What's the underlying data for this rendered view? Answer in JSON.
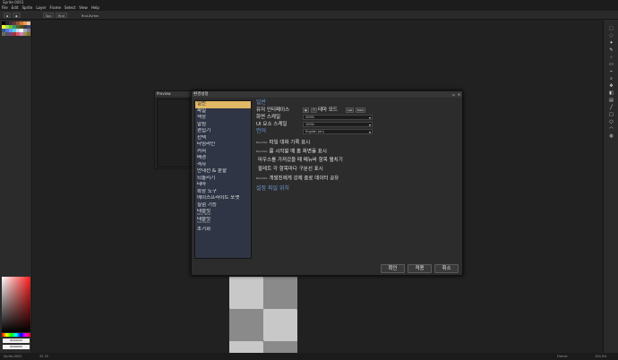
{
  "window": {
    "title": "Sprite-0001"
  },
  "menu": [
    "File",
    "Edit",
    "Sprite",
    "Layer",
    "Frame",
    "Select",
    "View",
    "Help"
  ],
  "toolbar": {
    "btn1": "Spc",
    "btn2": "Rnd",
    "label": "Rnd-Xvrtec"
  },
  "preview": {
    "title": "Preview"
  },
  "dialog": {
    "title": "환경설정",
    "nav": [
      "일반",
      "파일",
      "색상",
      "알림",
      "편집기",
      "선택",
      "타임라인",
      "커서",
      "배경",
      "격자",
      "안내선 & 분할",
      "되돌리기",
      "테마",
      "확장 도구",
      "에이스프라이트 포맷",
      "실험 기능"
    ],
    "nav_group1": {
      "label": "태블릿",
      "sub": "Bitsy, Tablet"
    },
    "nav_group2": {
      "label": "태블릿",
      "sub": "Fast Pointer"
    },
    "nav_reset": "초기화",
    "section_general": "일반",
    "ui_label": "유저 인터페이스",
    "theme_mode": "테마 모드",
    "theme_light": "Lwt",
    "theme_dark": "Dark",
    "screen_scale_label": "화면 스케일",
    "screen_scale_value": "200%",
    "ui_scale_label": "UI 요소 스케일",
    "ui_scale_value": "100%",
    "section_language": "언어",
    "language_value": "English (en)",
    "checks": [
      {
        "tag": "Rendrbx",
        "label": "파일 대화 기록 표시"
      },
      {
        "tag": "Rendrbx",
        "label": "를 시작할 때 홈 화면을 표시"
      },
      {
        "tag": "",
        "label": "마우스를 가져갔을 때 메뉴바 항목 펼치기"
      },
      {
        "tag": "",
        "label": "팔레트 각 항목마다 구분선 표시"
      },
      {
        "tag": "Rendrbx",
        "label": "개발진에게 강제 종료 데이터 공유"
      }
    ],
    "section_config": "설정 파일 위치",
    "buttons": {
      "ok": "확인",
      "apply": "적용",
      "cancel": "취소"
    }
  },
  "colorpicker": {
    "hex1": "#000000",
    "hex2": "#000000"
  },
  "status": {
    "left": "Sprite-0001",
    "coords": "32 32",
    "frame_label": "Frame:",
    "zoom": "100.0%"
  },
  "palette_colors": [
    "#000000",
    "#222034",
    "#45283c",
    "#663931",
    "#8f563b",
    "#df7126",
    "#d9a066",
    "#eec39a",
    "#fbf236",
    "#99e550",
    "#6abe30",
    "#37946e",
    "#4b692f",
    "#524b24",
    "#323c39",
    "#3f3f74",
    "#306082",
    "#5b6ee1",
    "#639bff",
    "#5fcde4",
    "#cbdbfc",
    "#ffffff",
    "#9badb7",
    "#847e87",
    "#696a6a",
    "#595652",
    "#76428a",
    "#ac3232",
    "#d95763",
    "#d77bba",
    "#8f974a",
    "#8a6f30"
  ]
}
